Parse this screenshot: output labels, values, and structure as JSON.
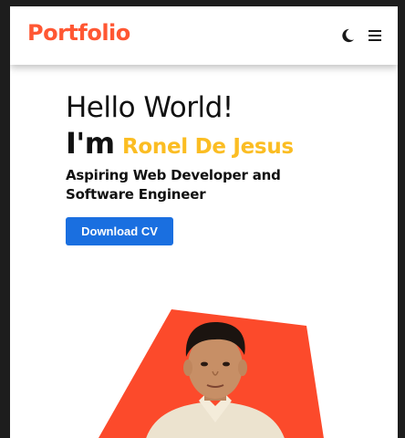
{
  "nav": {
    "logo": "Portfolio",
    "theme_icon": "moon-icon",
    "menu_icon": "hamburger-menu-icon"
  },
  "hero": {
    "greeting": "Hello World!",
    "im": "I'm",
    "name": "Ronel De Jesus",
    "tagline": "Aspiring Web Developer and Software Engineer",
    "cta_label": "Download CV"
  },
  "colors": {
    "brand": "#ff5733",
    "name_accent": "#fbbd23",
    "button": "#1a6fe0",
    "shape": "#fc4a2b"
  }
}
